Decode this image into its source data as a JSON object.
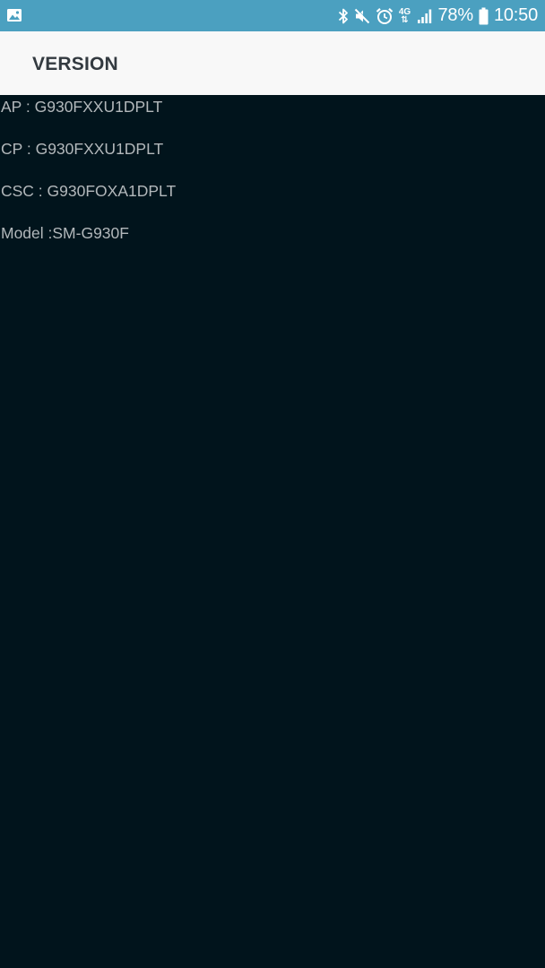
{
  "status_bar": {
    "left_icon": "image-icon",
    "icons": [
      "bluetooth-icon",
      "mute-icon",
      "alarm-icon",
      "network-4g-icon",
      "signal-icon",
      "battery-icon"
    ],
    "network_label_top": "4G",
    "battery_percent": "78%",
    "time": "10:50",
    "colors": {
      "background": "#4ba0c0",
      "foreground": "#ffffff"
    }
  },
  "app_bar": {
    "title": "VERSION",
    "background": "#f8f8f8"
  },
  "versions": [
    {
      "text": "AP : G930FXXU1DPLT"
    },
    {
      "text": "CP : G930FXXU1DPLT"
    },
    {
      "text": "CSC : G930FOXA1DPLT"
    },
    {
      "text": "Model :SM-G930F"
    }
  ],
  "colors": {
    "page_background": "#01141c",
    "text": "#b3b8bb"
  }
}
